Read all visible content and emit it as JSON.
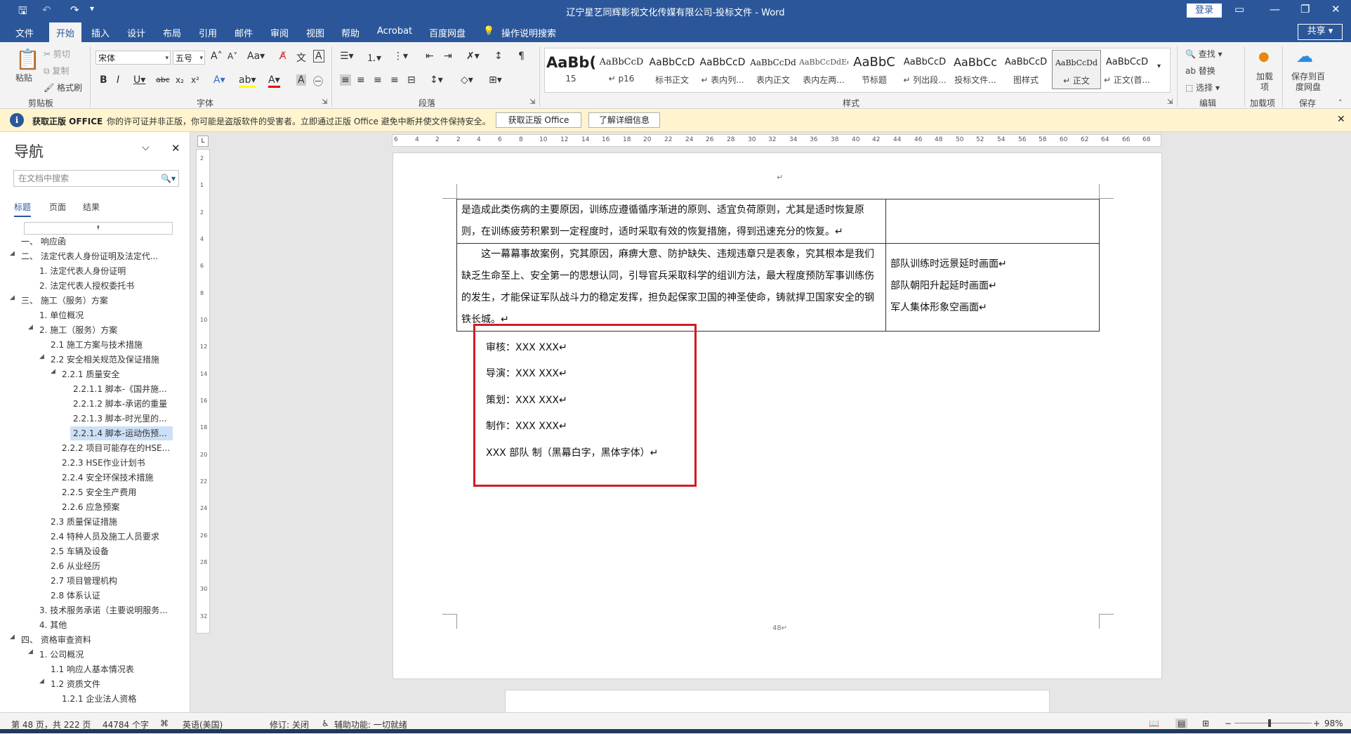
{
  "window": {
    "title": "辽宁星艺同辉影视文化传媒有限公司-投标文件  -  Word",
    "login_label": "登录",
    "share_label": "共享"
  },
  "tabs": [
    "文件",
    "开始",
    "插入",
    "设计",
    "布局",
    "引用",
    "邮件",
    "审阅",
    "视图",
    "帮助",
    "Acrobat",
    "百度网盘",
    "操作说明搜索"
  ],
  "active_tab": "开始",
  "ribbon": {
    "clipboard": {
      "paste": "粘贴",
      "cut": "剪切",
      "copy": "复制",
      "format_painter": "格式刷",
      "group": "剪贴板"
    },
    "font": {
      "name": "宋体",
      "size": "五号",
      "group": "字体"
    },
    "paragraph": {
      "group": "段落"
    },
    "styles": {
      "group": "样式",
      "items": [
        {
          "preview": "AaBb(",
          "name": "15"
        },
        {
          "preview": "AaBbCcD",
          "name": "↵ p16"
        },
        {
          "preview": "AaBbCcD",
          "name": "标书正文"
        },
        {
          "preview": "AaBbCcD",
          "name": "↵ 表内列..."
        },
        {
          "preview": "AaBbCcDd",
          "name": "表内正文"
        },
        {
          "preview": "AaBbCcDdEe",
          "name": "表内左两..."
        },
        {
          "preview": "AaBbC",
          "name": "节标题"
        },
        {
          "preview": "AaBbCcD",
          "name": "↵ 列出段..."
        },
        {
          "preview": "AaBbCc",
          "name": "投标文件..."
        },
        {
          "preview": "AaBbCcD",
          "name": "图样式"
        },
        {
          "preview": "AaBbCcDd",
          "name": "↵ 正文"
        },
        {
          "preview": "AaBbCcD",
          "name": "↵ 正文(首..."
        }
      ]
    },
    "editing": {
      "find": "查找",
      "replace": "替换",
      "select": "选择",
      "group": "编辑"
    },
    "addins": {
      "label": "加载项",
      "group": "加载项"
    },
    "baidu": {
      "label": "保存到百度网盘",
      "group": "保存"
    }
  },
  "infobar": {
    "title": "获取正版 OFFICE",
    "message": "你的许可证并非正版，你可能是盗版软件的受害者。立即通过正版 Office 避免中断并使文件保持安全。",
    "btn_get": "获取正版 Office",
    "btn_more": "了解详细信息"
  },
  "nav": {
    "title": "导航",
    "search_placeholder": "在文档中搜索",
    "tabs": [
      "标题",
      "页面",
      "结果"
    ],
    "items": [
      {
        "text": "一、 响应函",
        "level": 1,
        "tri": ""
      },
      {
        "text": "二、 法定代表人身份证明及法定代...",
        "level": 1,
        "tri": "◢"
      },
      {
        "text": "1. 法定代表人身份证明",
        "level": 2,
        "tri": ""
      },
      {
        "text": "2. 法定代表人授权委托书",
        "level": 2,
        "tri": ""
      },
      {
        "text": "三、 施工（服务）方案",
        "level": 1,
        "tri": "◢"
      },
      {
        "text": "1. 单位概况",
        "level": 2,
        "tri": ""
      },
      {
        "text": "2. 施工（服务）方案",
        "level": 2,
        "tri": "◢"
      },
      {
        "text": "2.1 施工方案与技术措施",
        "level": 3,
        "tri": ""
      },
      {
        "text": "2.2 安全相关规范及保证措施",
        "level": 3,
        "tri": "◢"
      },
      {
        "text": "2.2.1 质量安全",
        "level": 4,
        "tri": "◢"
      },
      {
        "text": "2.2.1.1 脚本-《国井施...",
        "level": 5,
        "tri": ""
      },
      {
        "text": "2.2.1.2 脚本-承诺的重量",
        "level": 5,
        "tri": ""
      },
      {
        "text": "2.2.1.3 脚本-时光里的...",
        "level": 5,
        "tri": ""
      },
      {
        "text": "2.2.1.4 脚本-运动伤预...",
        "level": 5,
        "tri": "",
        "selected": true
      },
      {
        "text": "2.2.2 项目可能存在的HSE...",
        "level": 4,
        "tri": ""
      },
      {
        "text": "2.2.3 HSE作业计划书",
        "level": 4,
        "tri": ""
      },
      {
        "text": "2.2.4 安全环保技术措施",
        "level": 4,
        "tri": ""
      },
      {
        "text": "2.2.5 安全生产费用",
        "level": 4,
        "tri": ""
      },
      {
        "text": "2.2.6 应急预案",
        "level": 4,
        "tri": ""
      },
      {
        "text": "2.3 质量保证措施",
        "level": 3,
        "tri": ""
      },
      {
        "text": "2.4 特种人员及施工人员要求",
        "level": 3,
        "tri": ""
      },
      {
        "text": "2.5 车辆及设备",
        "level": 3,
        "tri": ""
      },
      {
        "text": "2.6 从业经历",
        "level": 3,
        "tri": ""
      },
      {
        "text": "2.7 项目管理机构",
        "level": 3,
        "tri": ""
      },
      {
        "text": "2.8 体系认证",
        "level": 3,
        "tri": ""
      },
      {
        "text": "3. 技术服务承诺（主要说明服务...",
        "level": 2,
        "tri": ""
      },
      {
        "text": "4. 其他",
        "level": 2,
        "tri": ""
      },
      {
        "text": "四、 资格审查资料",
        "level": 1,
        "tri": "◢"
      },
      {
        "text": "1. 公司概况",
        "level": 2,
        "tri": "◢"
      },
      {
        "text": "1.1 响应人基本情况表",
        "level": 3,
        "tri": ""
      },
      {
        "text": "1.2 资质文件",
        "level": 3,
        "tri": "◢"
      },
      {
        "text": "1.2.1 企业法人资格",
        "level": 4,
        "tri": ""
      }
    ]
  },
  "ruler": {
    "h_ticks": [
      "6",
      "4",
      "2",
      "2",
      "4",
      "6",
      "8",
      "10",
      "12",
      "14",
      "16",
      "18",
      "20",
      "22",
      "24",
      "26",
      "28",
      "30",
      "32",
      "34",
      "36",
      "38",
      "40",
      "42",
      "44",
      "46",
      "48",
      "50",
      "52",
      "54",
      "56",
      "58",
      "60",
      "62",
      "64",
      "66",
      "68"
    ],
    "v_ticks": [
      "2",
      "1",
      "2",
      "4",
      "6",
      "8",
      "10",
      "12",
      "14",
      "16",
      "18",
      "20",
      "22",
      "24",
      "26",
      "28",
      "30",
      "32"
    ]
  },
  "document": {
    "top_mark": "↵",
    "row1_left": "是造成此类伤病的主要原因，训练应遵循循序渐进的原则、适宜负荷原则，尤其是适时恢复原则，在训练疲劳积累到一定程度时，适时采取有效的恢复措施，得到迅速充分的恢复。↵",
    "row2_left": "　　这一幕幕事故案例，究其原因，麻痹大意、防护缺失、违规违章只是表象，究其根本是我们缺乏生命至上、安全第一的思想认同，引导官兵采取科学的组训方法，最大程度预防军事训练伤的发生，才能保证军队战斗力的稳定发挥，担负起保家卫国的神圣使命，铸就捍卫国家安全的钢铁长城。↵",
    "row2_right": [
      "部队训练时远景延时画面↵",
      "部队朝阳升起延时画面↵",
      "军人集体形象空画面↵"
    ],
    "credits": [
      "审核：XXX  XXX↵",
      "导演：XXX  XXX↵",
      "策划：XXX  XXX↵",
      "制作：XXX  XXX↵",
      "XXX 部队  制（黑幕白字，黑体字体）↵"
    ],
    "page_number": "48↵"
  },
  "status": {
    "page": "第 48 页，共 222 页",
    "words": "44784 个字",
    "language": "英语(美国)",
    "track": "修订: 关闭",
    "accessibility": "辅助功能: 一切就绪",
    "zoom": "98%"
  }
}
